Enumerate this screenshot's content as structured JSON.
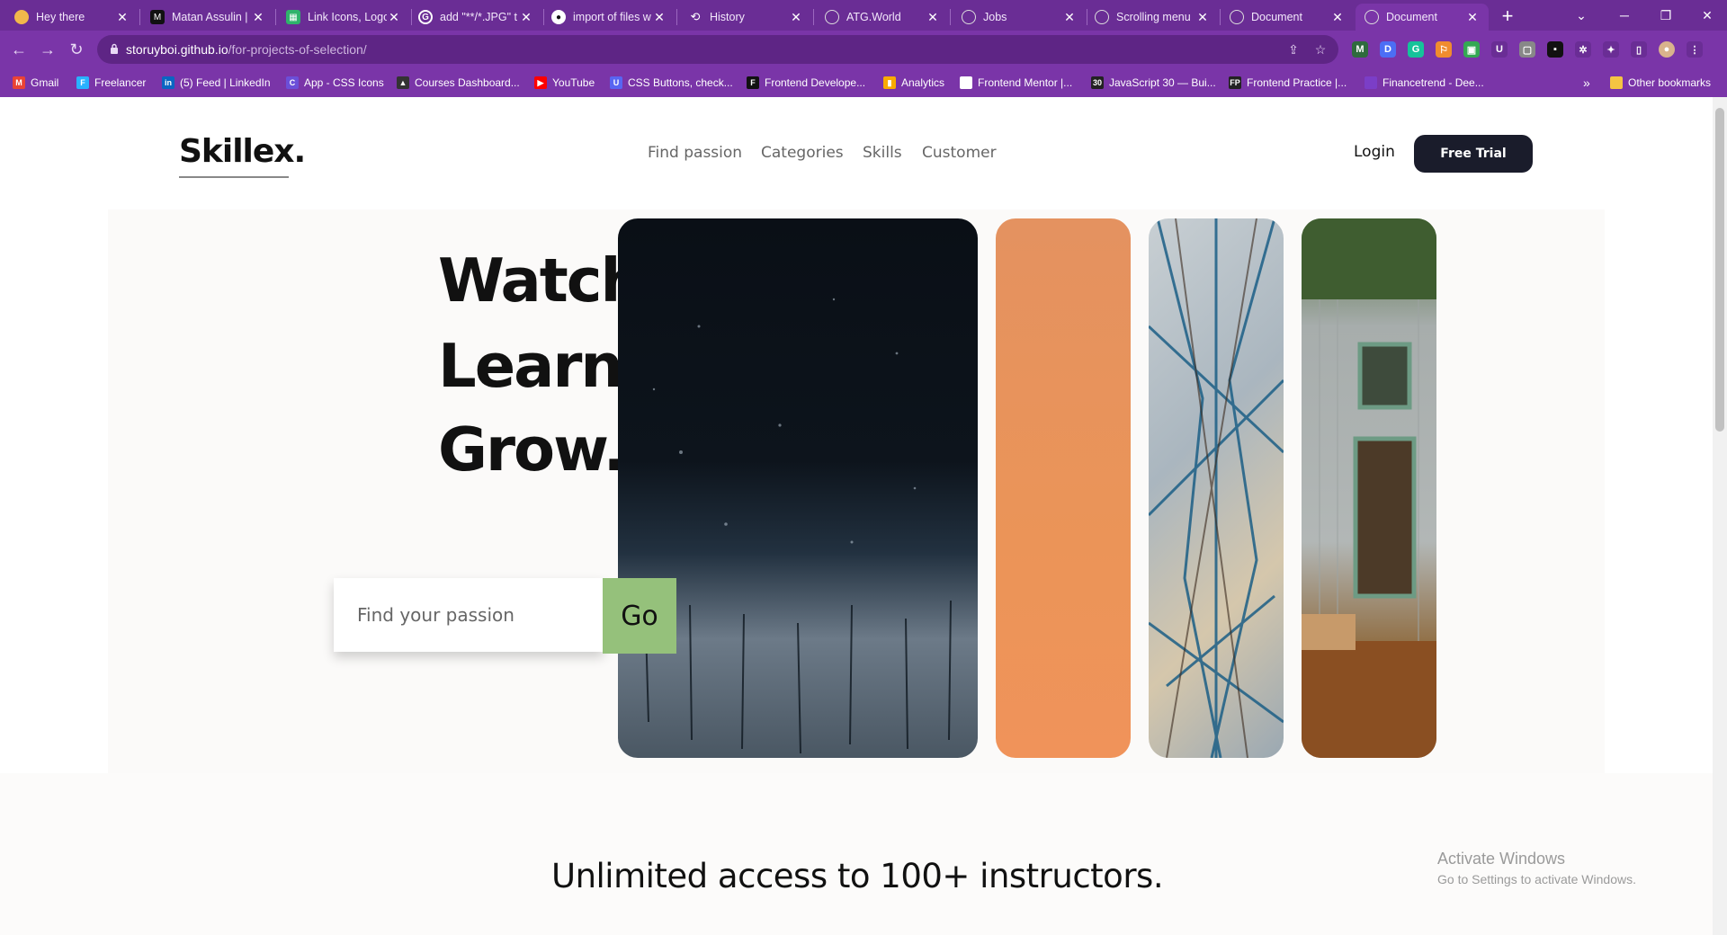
{
  "browser": {
    "tabs": [
      {
        "label": "Hey there",
        "favicon_color": "#f2b84b",
        "icon": "circle"
      },
      {
        "label": "Matan Assulin |",
        "favicon_color": "#111111",
        "icon": "M"
      },
      {
        "label": "Link Icons, Logo",
        "favicon_color": "#2fb36b",
        "icon": "grid"
      },
      {
        "label": "add \"**/*.JPG\" t",
        "favicon_color": "#ffffff",
        "icon": "G"
      },
      {
        "label": "import of files w",
        "favicon_color": "#ffffff",
        "icon": "github"
      },
      {
        "label": "History",
        "favicon_color": "#ffffff",
        "icon": "history"
      },
      {
        "label": "ATG.World",
        "favicon_color": "#ffffff",
        "icon": "globe"
      },
      {
        "label": "Jobs",
        "favicon_color": "#ffffff",
        "icon": "globe"
      },
      {
        "label": "Scrolling menu",
        "favicon_color": "#ffffff",
        "icon": "globe"
      },
      {
        "label": "Document",
        "favicon_color": "#ffffff",
        "icon": "globe"
      },
      {
        "label": "Document",
        "favicon_color": "#ffffff",
        "icon": "globe",
        "active": true
      }
    ],
    "url_host": "storuyboi.github.io",
    "url_path": "/for-projects-of-selection/",
    "bookmarks": [
      {
        "label": "Gmail",
        "color": "#ea4335",
        "glyph": "M"
      },
      {
        "label": "Freelancer",
        "color": "#29b2fe",
        "glyph": "F"
      },
      {
        "label": "(5) Feed | LinkedIn",
        "color": "#0a66c2",
        "glyph": "in"
      },
      {
        "label": "App - CSS Icons",
        "color": "#6b4fd8",
        "glyph": "C"
      },
      {
        "label": "Courses Dashboard...",
        "color": "#333333",
        "glyph": "▲"
      },
      {
        "label": "YouTube",
        "color": "#ff0000",
        "glyph": "▶"
      },
      {
        "label": "CSS Buttons, check...",
        "color": "#5865f2",
        "glyph": "U"
      },
      {
        "label": "Frontend Develope...",
        "color": "#111111",
        "glyph": "F"
      },
      {
        "label": "Analytics",
        "color": "#f9ab00",
        "glyph": "▮"
      },
      {
        "label": "Frontend Mentor |...",
        "color": "#ffffff",
        "glyph": ""
      },
      {
        "label": "JavaScript 30 — Bui...",
        "color": "#222222",
        "glyph": "30"
      },
      {
        "label": "Frontend Practice |...",
        "color": "#222222",
        "glyph": "FP"
      },
      {
        "label": "Financetrend - Dee...",
        "color": "#7b3ec7",
        "glyph": ""
      }
    ],
    "other_bookmarks": "Other bookmarks",
    "overflow": "»"
  },
  "site": {
    "logo": "Skillex.",
    "nav": [
      "Find passion",
      "Categories",
      "Skills",
      "Customer"
    ],
    "login": "Login",
    "free_trial": "Free Trial",
    "hero": {
      "line1": "Watch.",
      "line2": "Learn.",
      "line3": "Grow.",
      "search_placeholder": "Find your passion",
      "go": "Go"
    },
    "instructors": "Unlimited access to 100+ instructors."
  },
  "os": {
    "activate_title": "Activate Windows",
    "activate_sub": "Go to Settings to activate Windows."
  }
}
